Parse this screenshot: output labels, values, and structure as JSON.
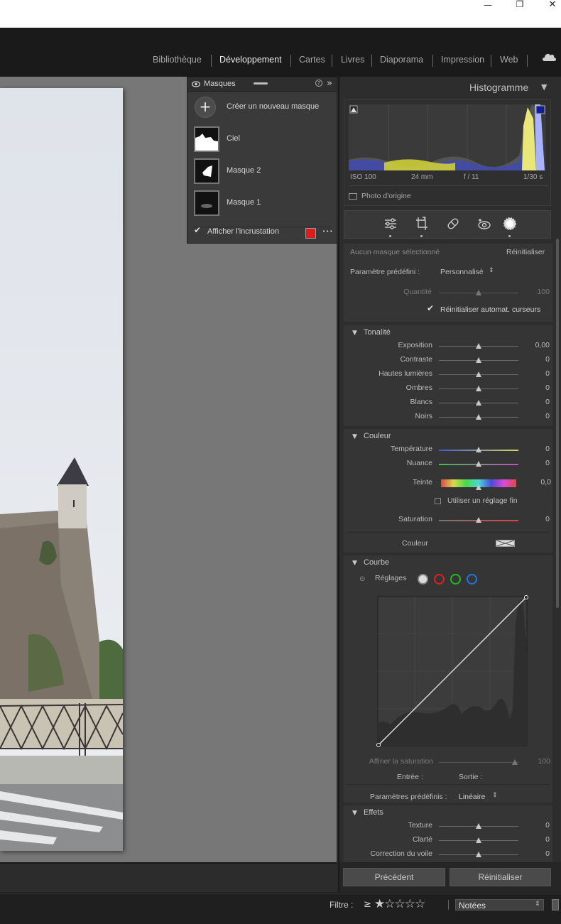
{
  "window": {
    "minimize_glyph": "—",
    "restore_glyph": "❐",
    "close_glyph": "✕"
  },
  "modules": [
    "Bibliothèque",
    "Développement",
    "Cartes",
    "Livres",
    "Diaporama",
    "Impression",
    "Web"
  ],
  "active_module": "Développement",
  "masks": {
    "title": "Masques",
    "help_glyph": "?",
    "collapse_glyph": "»",
    "create_label": "Créer un nouveau masque",
    "items": [
      "Ciel",
      "Masque 2",
      "Masque 1"
    ],
    "overlay_label": "Afficher l'incrustation",
    "overlay_checked": true,
    "overlay_color": "#e01b1b",
    "more_glyph": "•••"
  },
  "histogram": {
    "title": "Histogramme",
    "iso": "ISO 100",
    "focal": "24 mm",
    "aperture": "f / 11",
    "shutter": "1/30 s",
    "original_label": "Photo d'origine"
  },
  "tools": [
    "sliders-icon",
    "crop-icon",
    "healing-icon",
    "redeye-icon",
    "mask-icon"
  ],
  "mask_panel": {
    "no_mask": "Aucun masque sélectionné",
    "reset": "Réinitialiser",
    "preset_label": "Paramètre prédéfini :",
    "preset_value": "Personnalisé",
    "amount_label": "Quantité",
    "amount_value": "100",
    "auto_reset_label": "Réinitialiser automat. curseurs"
  },
  "tone": {
    "title": "Tonalité",
    "sliders": [
      {
        "label": "Exposition",
        "value": "0,00"
      },
      {
        "label": "Contraste",
        "value": "0"
      },
      {
        "label": "Hautes lumières",
        "value": "0"
      },
      {
        "label": "Ombres",
        "value": "0"
      },
      {
        "label": "Blancs",
        "value": "0"
      },
      {
        "label": "Noirs",
        "value": "0"
      }
    ]
  },
  "color": {
    "title": "Couleur",
    "temp_label": "Température",
    "temp_value": "0",
    "tint_label": "Nuance",
    "tint_value": "0",
    "hue_label": "Teinte",
    "hue_value": "0,0",
    "fine_label": "Utiliser un réglage fin",
    "sat_label": "Saturation",
    "sat_value": "0",
    "swatch_label": "Couleur"
  },
  "curve": {
    "title": "Courbe",
    "adjust_label": "Réglages",
    "refine_label": "Affiner la saturation",
    "refine_value": "100",
    "input_label": "Entrée :",
    "output_label": "Sortie :",
    "presets_label": "Paramètres prédéfinis :",
    "presets_value": "Linéaire"
  },
  "effects": {
    "title": "Effets",
    "sliders": [
      {
        "label": "Texture",
        "value": "0"
      },
      {
        "label": "Clarté",
        "value": "0"
      },
      {
        "label": "Correction du voile",
        "value": "0"
      }
    ]
  },
  "buttons": {
    "previous": "Précédent",
    "reset": "Réinitialiser"
  },
  "filter": {
    "label": "Filtre :",
    "gte": "≥",
    "stars_glyph": "★☆☆☆☆",
    "value": "Notées"
  },
  "colors": {
    "accent_text": "#ececec",
    "panel": "#2d2d2d",
    "overlay_red": "#e01b1b"
  }
}
